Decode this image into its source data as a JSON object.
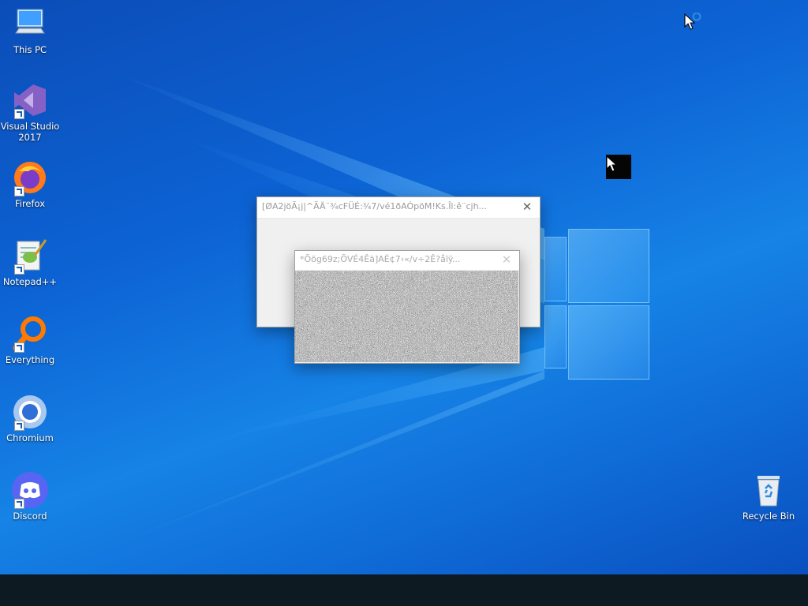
{
  "desktop": {
    "icons": [
      {
        "label": "This PC",
        "icon": "computer-icon"
      },
      {
        "label": "Visual Studio 2017",
        "icon": "visual-studio-icon"
      },
      {
        "label": "Firefox",
        "icon": "firefox-icon"
      },
      {
        "label": "Notepad++",
        "icon": "notepadpp-icon"
      },
      {
        "label": "Everything",
        "icon": "everything-search-icon"
      },
      {
        "label": "Chromium",
        "icon": "chromium-icon"
      },
      {
        "label": "Discord",
        "icon": "discord-icon"
      },
      {
        "label": "Recycle Bin",
        "icon": "recycle-bin-icon"
      }
    ]
  },
  "windows": {
    "back": {
      "title": "[ØA2jöÃ¡j|^ÃÄ¨¾cFÜÉ:¾7/vé1ðAÓpöM!Ks.Îl:ê¨cjh...",
      "close_symbol": "✕"
    },
    "front": {
      "title": "*Õõg69z;ÕVÉ4Êä]AÉ¢7‹«/v÷2Ê?åïÿ...",
      "close_symbol": "✕"
    }
  },
  "colors": {
    "desktop_blue": "#0d63d4",
    "taskbar": "#0e1a22",
    "window_bg": "#f0f0f0"
  }
}
